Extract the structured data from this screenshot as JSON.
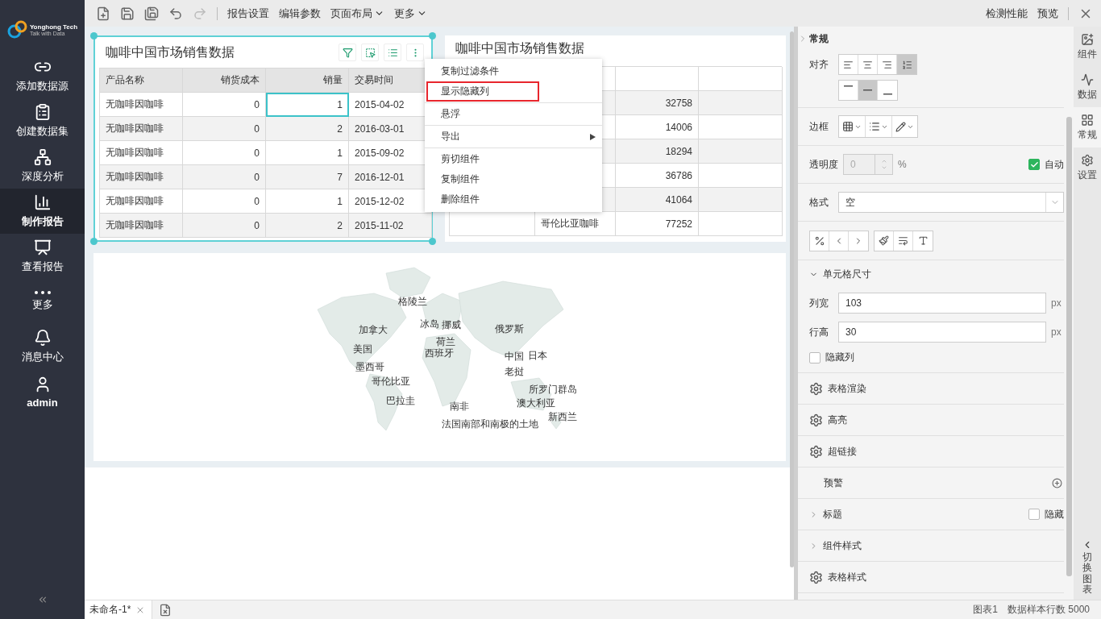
{
  "logo": {
    "name": "Yonghong Tech",
    "tagline": "Talk with Data"
  },
  "sidebar": {
    "items": [
      {
        "label": "添加数据源",
        "kind": "link",
        "selected": false
      },
      {
        "label": "创建数据集",
        "kind": "dataset",
        "selected": false
      },
      {
        "label": "深度分析",
        "kind": "analysis",
        "selected": false
      },
      {
        "label": "制作报告",
        "kind": "report",
        "selected": true
      },
      {
        "label": "查看报告",
        "kind": "view",
        "selected": false
      },
      {
        "label": "更多",
        "kind": "more",
        "selected": false
      },
      {
        "label": "消息中心",
        "kind": "bell",
        "selected": false
      },
      {
        "label": "admin",
        "kind": "user",
        "selected": false
      }
    ]
  },
  "toolbar": {
    "menus": [
      {
        "label": "报告设置",
        "dropdown": false
      },
      {
        "label": "编辑参数",
        "dropdown": false
      },
      {
        "label": "页面布局",
        "dropdown": true
      },
      {
        "label": "更多",
        "dropdown": true
      }
    ],
    "actions": [
      "检测性能",
      "预览"
    ]
  },
  "table_1": {
    "title": "咖啡中国市场销售数据",
    "columns": [
      {
        "label": "产品名称",
        "kind": "text"
      },
      {
        "label": "销货成本",
        "kind": "number"
      },
      {
        "label": "销量",
        "kind": "number"
      },
      {
        "label": "交易时间",
        "kind": "date"
      }
    ],
    "rows": [
      [
        {
          "text": "无咖啡因咖啡",
          "selected": false
        },
        {
          "text": "0",
          "selected": false
        },
        {
          "text": "1",
          "selected": true
        },
        {
          "text": "2015-04-02",
          "selected": false
        }
      ],
      [
        {
          "text": "无咖啡因咖啡",
          "selected": false
        },
        {
          "text": "0",
          "selected": false
        },
        {
          "text": "2",
          "selected": false
        },
        {
          "text": "2016-03-01",
          "selected": false
        }
      ],
      [
        {
          "text": "无咖啡因咖啡",
          "selected": false
        },
        {
          "text": "0",
          "selected": false
        },
        {
          "text": "1",
          "selected": false
        },
        {
          "text": "2015-09-02",
          "selected": false
        }
      ],
      [
        {
          "text": "无咖啡因咖啡",
          "selected": false
        },
        {
          "text": "0",
          "selected": false
        },
        {
          "text": "7",
          "selected": false
        },
        {
          "text": "2016-12-01",
          "selected": false
        }
      ],
      [
        {
          "text": "无咖啡因咖啡",
          "selected": false
        },
        {
          "text": "0",
          "selected": false
        },
        {
          "text": "1",
          "selected": false
        },
        {
          "text": "2015-12-02",
          "selected": false
        }
      ],
      [
        {
          "text": "无咖啡因咖啡",
          "selected": false
        },
        {
          "text": "0",
          "selected": false
        },
        {
          "text": "2",
          "selected": false
        },
        {
          "text": "2015-11-02",
          "selected": false
        }
      ]
    ]
  },
  "table_2": {
    "title": "咖啡中国市场销售数据",
    "rows": [
      {
        "value": "32758"
      },
      {
        "value": "14006"
      },
      {
        "value": "18294"
      },
      {
        "value": "36786"
      },
      {
        "value": "41064"
      },
      {
        "product": "哥伦比亚咖啡",
        "value": "77252"
      }
    ]
  },
  "context_menu": {
    "groups": [
      [
        {
          "label": "复制过滤条件",
          "outlined": false,
          "submenu": false
        },
        {
          "label": "显示隐藏列",
          "outlined": true,
          "submenu": false
        }
      ],
      [
        {
          "label": "悬浮",
          "outlined": false,
          "submenu": false
        }
      ],
      [
        {
          "label": "导出",
          "outlined": false,
          "submenu": true
        }
      ],
      [
        {
          "label": "剪切组件",
          "outlined": false,
          "submenu": false
        },
        {
          "label": "复制组件",
          "outlined": false,
          "submenu": false
        },
        {
          "label": "删除组件",
          "outlined": false,
          "submenu": false
        }
      ]
    ]
  },
  "map": {
    "labels": [
      "格陵兰",
      "加拿大",
      "冰岛",
      "挪威",
      "俄罗斯",
      "荷兰",
      "美国",
      "西班牙",
      "中国",
      "日本",
      "墨西哥",
      "老挝",
      "哥伦比亚",
      "所罗门群岛",
      "巴拉圭",
      "南非",
      "澳大利亚",
      "新西兰",
      "法国南部和南极的土地"
    ]
  },
  "properties": {
    "header": "常规",
    "align_label": "对齐",
    "h_align": [
      {
        "selected": false
      },
      {
        "selected": false
      },
      {
        "selected": false
      },
      {
        "selected": true
      }
    ],
    "v_align": [
      {
        "selected": false
      },
      {
        "selected": true
      },
      {
        "selected": false
      }
    ],
    "border_label": "边框",
    "opacity": {
      "label": "透明度",
      "value": "0",
      "disabled": true,
      "unit": "%",
      "auto": {
        "label": "自动",
        "checked": true
      }
    },
    "format": {
      "label": "格式",
      "value": "空"
    },
    "cell_size": {
      "title": "单元格尺寸",
      "expanded": true,
      "width": {
        "label": "列宽",
        "value": "103",
        "unit": "px"
      },
      "height": {
        "label": "行高",
        "value": "30",
        "unit": "px"
      },
      "hide_column": {
        "label": "隐藏列",
        "checked": false
      }
    },
    "sections": [
      {
        "kind": "gear",
        "label": "表格渲染"
      },
      {
        "kind": "gear",
        "label": "高亮"
      },
      {
        "kind": "gear",
        "label": "超链接"
      },
      {
        "kind": "plus",
        "label": "预警"
      },
      {
        "kind": "collapsed",
        "label": "标题",
        "hide": {
          "label": "隐藏",
          "checked": false
        }
      },
      {
        "kind": "collapsed",
        "label": "组件样式"
      },
      {
        "kind": "gear",
        "label": "表格样式"
      }
    ]
  },
  "right_tabs": [
    {
      "label": "组件",
      "kind": "component",
      "selected": false
    },
    {
      "label": "数据",
      "kind": "data",
      "selected": false
    },
    {
      "label": "常规",
      "kind": "general",
      "selected": true
    },
    {
      "label": "设置",
      "kind": "settings",
      "selected": false
    }
  ],
  "switch_chart": "切换图表",
  "bottom": {
    "tab": "未命名-1*",
    "status": [
      "图表1",
      "数据样本行数 5000"
    ]
  }
}
